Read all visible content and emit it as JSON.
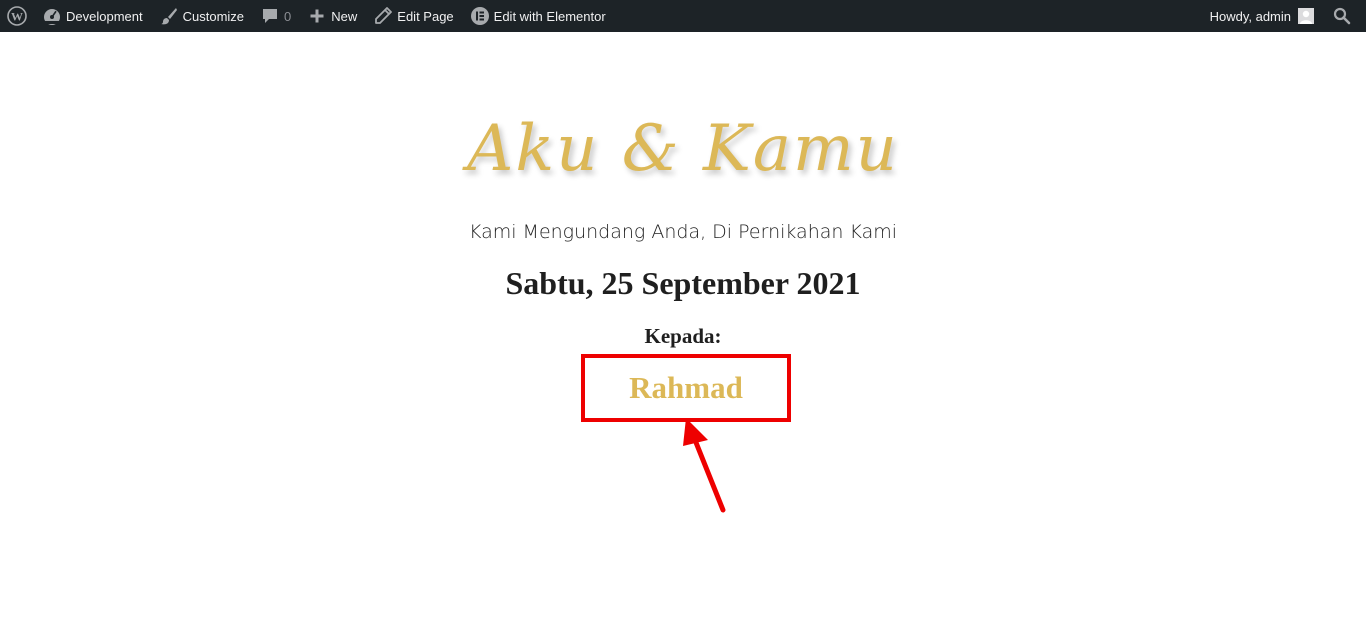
{
  "adminbar": {
    "site_name": "Development",
    "customize": "Customize",
    "comments_count": "0",
    "new": "New",
    "edit_page": "Edit Page",
    "edit_elementor": "Edit with Elementor",
    "howdy": "Howdy, admin"
  },
  "invitation": {
    "couple": "Aku & Kamu",
    "intro": "Kami Mengundang Anda, Di Pernikahan Kami",
    "date": "Sabtu, 25 September 2021",
    "to_label": "Kepada:",
    "guest_name": "Rahmad"
  },
  "colors": {
    "adminbar_bg": "#1d2327",
    "gold": "#dcb857",
    "highlight": "#ee0000"
  }
}
